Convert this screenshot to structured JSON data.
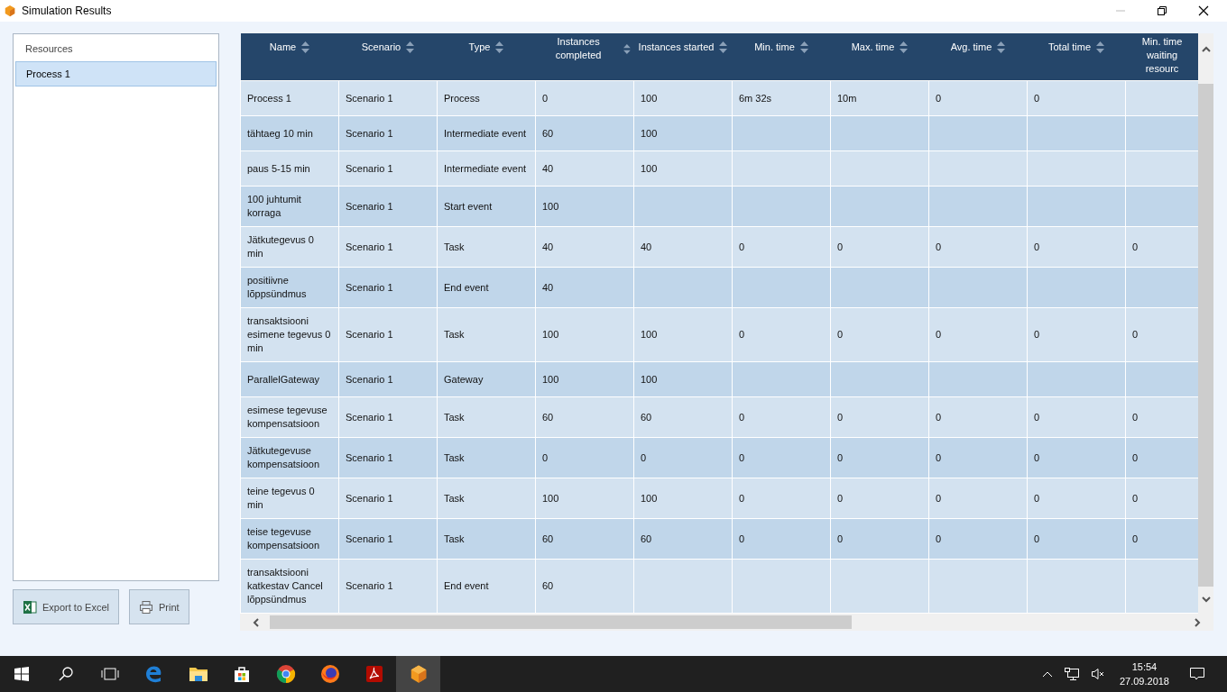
{
  "window": {
    "title": "Simulation Results"
  },
  "sidebar": {
    "title": "Resources",
    "items": [
      {
        "label": "Process 1",
        "selected": true
      }
    ]
  },
  "buttons": [
    {
      "kind": "excel",
      "label": "Export to Excel"
    },
    {
      "kind": "print",
      "label": "Print"
    }
  ],
  "table": {
    "columns": [
      "Name",
      "Scenario",
      "Type",
      "Instances completed",
      "Instances started",
      "Min. time",
      "Max. time",
      "Avg. time",
      "Total time",
      "Min. time waiting resourc"
    ],
    "rows": [
      [
        "Process 1",
        "Scenario 1",
        "Process",
        "0",
        "100",
        "6m 32s",
        "10m",
        "0",
        "0",
        ""
      ],
      [
        "tähtaeg 10 min",
        "Scenario 1",
        "Intermediate event",
        "60",
        "100",
        "",
        "",
        "",
        "",
        ""
      ],
      [
        "paus 5-15 min",
        "Scenario 1",
        "Intermediate event",
        "40",
        "100",
        "",
        "",
        "",
        "",
        ""
      ],
      [
        "100 juhtumit korraga",
        "Scenario 1",
        "Start event",
        "100",
        "",
        "",
        "",
        "",
        "",
        ""
      ],
      [
        "Jätkutegevus 0 min",
        "Scenario 1",
        "Task",
        "40",
        "40",
        "0",
        "0",
        "0",
        "0",
        "0"
      ],
      [
        "positiivne lõppsündmus",
        "Scenario 1",
        "End event",
        "40",
        "",
        "",
        "",
        "",
        "",
        ""
      ],
      [
        "transaktsiooni esimene tegevus 0 min",
        "Scenario 1",
        "Task",
        "100",
        "100",
        "0",
        "0",
        "0",
        "0",
        "0"
      ],
      [
        "ParallelGateway",
        "Scenario 1",
        "Gateway",
        "100",
        "100",
        "",
        "",
        "",
        "",
        ""
      ],
      [
        "esimese tegevuse kompensatsioon",
        "Scenario 1",
        "Task",
        "60",
        "60",
        "0",
        "0",
        "0",
        "0",
        "0"
      ],
      [
        "Jätkutegevuse kompensatsioon",
        "Scenario 1",
        "Task",
        "0",
        "0",
        "0",
        "0",
        "0",
        "0",
        "0"
      ],
      [
        "teine tegevus 0 min",
        "Scenario 1",
        "Task",
        "100",
        "100",
        "0",
        "0",
        "0",
        "0",
        "0"
      ],
      [
        "teise tegevuse kompensatsioon",
        "Scenario 1",
        "Task",
        "60",
        "60",
        "0",
        "0",
        "0",
        "0",
        "0"
      ],
      [
        "transaktsiooni katkestav Cancel lõppsündmus",
        "Scenario 1",
        "End event",
        "60",
        "",
        "",
        "",
        "",
        "",
        ""
      ]
    ]
  },
  "taskbar": {
    "time": "15:54",
    "date": "27.09.2018"
  }
}
